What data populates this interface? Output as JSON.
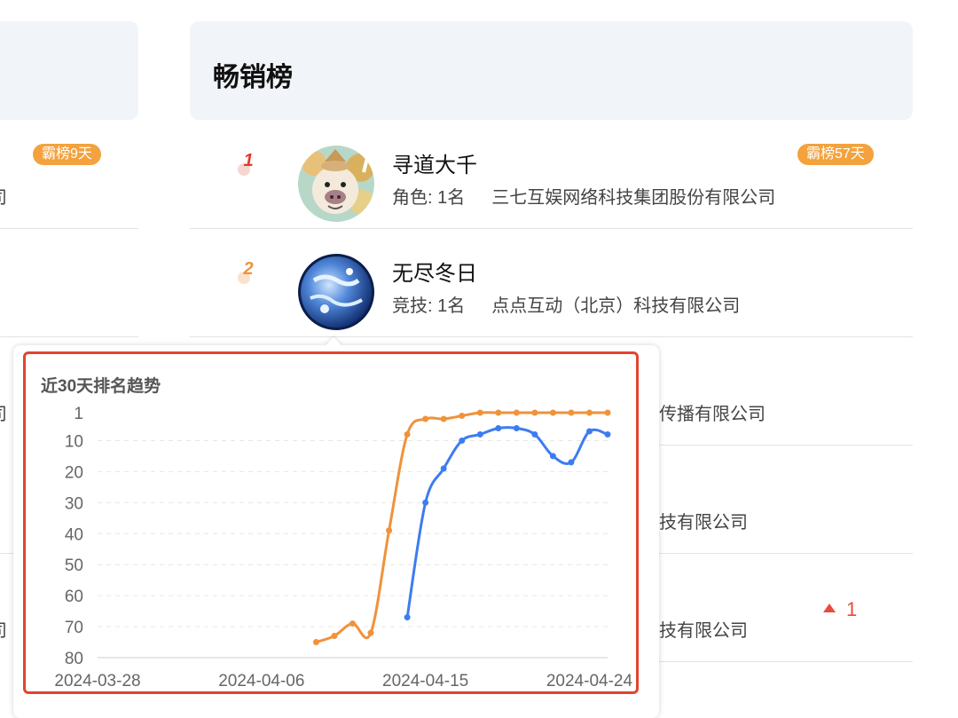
{
  "section": {
    "title": "畅销榜"
  },
  "left_column": {
    "badge": "霸榜9天",
    "fragments": [
      "司",
      "司",
      "司"
    ]
  },
  "rows": [
    {
      "rank": "1",
      "name": "寻道大千",
      "category": "角色: 1名",
      "company": "三七互娱网络科技集团股份有限公司",
      "badge": "霸榜57天",
      "avatar_icon": "pig-character-avatar"
    },
    {
      "rank": "2",
      "name": "无尽冬日",
      "category": "竞技: 1名",
      "company": "点点互动（北京）科技有限公司",
      "avatar_icon": "frozen-planet-avatar"
    }
  ],
  "right_fragments": [
    "传播有限公司",
    "技有限公司",
    "技有限公司"
  ],
  "rank_change": {
    "value": "1",
    "direction": "up",
    "color": "#e64b3c"
  },
  "tooltip": {
    "chart_title": "近30天排名趋势"
  },
  "chart_data": {
    "type": "line",
    "title": "近30天排名趋势",
    "x_tick_labels": [
      "2024-03-28",
      "2024-04-06",
      "2024-04-15",
      "2024-04-24"
    ],
    "x_range": [
      "2024-03-28",
      "2024-04-25"
    ],
    "y_tick_labels": [
      "1",
      "10",
      "20",
      "30",
      "40",
      "50",
      "60",
      "70",
      "80"
    ],
    "y_range": [
      1,
      80
    ],
    "y_inverted": true,
    "grid": true,
    "series": [
      {
        "color": "#f0923a",
        "x": [
          "2024-04-09",
          "2024-04-10",
          "2024-04-11",
          "2024-04-12",
          "2024-04-13",
          "2024-04-14",
          "2024-04-15",
          "2024-04-16",
          "2024-04-17",
          "2024-04-18",
          "2024-04-19",
          "2024-04-20",
          "2024-04-21",
          "2024-04-22",
          "2024-04-23",
          "2024-04-24",
          "2024-04-25"
        ],
        "y": [
          75,
          73,
          69,
          72,
          39,
          8,
          3,
          3,
          2,
          1,
          1,
          1,
          1,
          1,
          1,
          1,
          1
        ]
      },
      {
        "color": "#3d7cf0",
        "x": [
          "2024-04-14",
          "2024-04-15",
          "2024-04-16",
          "2024-04-17",
          "2024-04-18",
          "2024-04-19",
          "2024-04-20",
          "2024-04-21",
          "2024-04-22",
          "2024-04-23",
          "2024-04-24",
          "2024-04-25"
        ],
        "y": [
          67,
          30,
          19,
          10,
          8,
          6,
          6,
          8,
          15,
          17,
          7,
          8
        ]
      }
    ]
  }
}
